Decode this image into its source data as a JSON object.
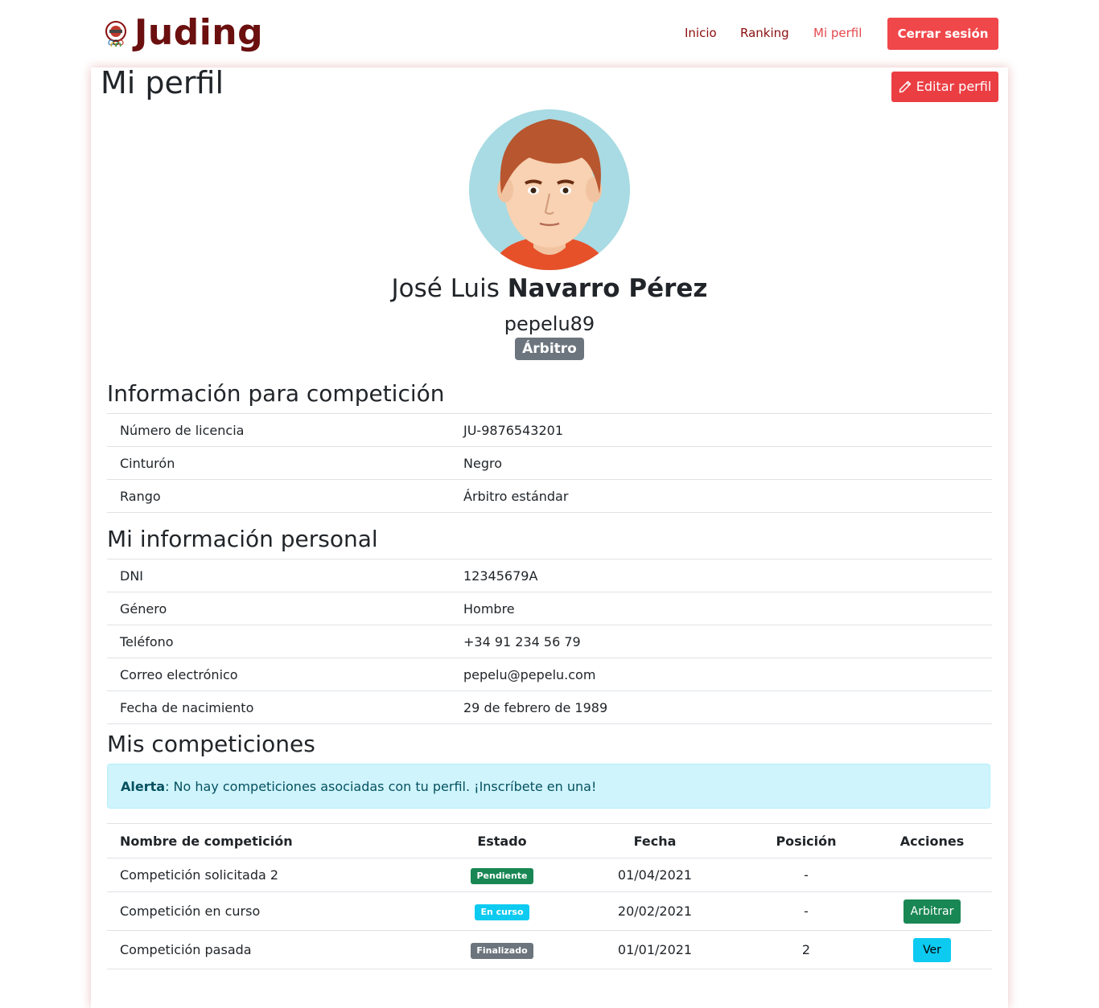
{
  "nav": {
    "brand": "Juding",
    "links": [
      "Inicio",
      "Ranking",
      "Mi perfil"
    ],
    "logout_label": "Cerrar sesión"
  },
  "profile": {
    "title": "Mi perfil",
    "edit_label": "Editar perfil",
    "first_name": "José Luis",
    "last_name": "Navarro Pérez",
    "username": "pepelu89",
    "role": "Árbitro"
  },
  "competition_info": {
    "title": "Información para competición",
    "rows": [
      {
        "label": "Número de licencia",
        "value": "JU-9876543201"
      },
      {
        "label": "Cinturón",
        "value": "Negro"
      },
      {
        "label": "Rango",
        "value": "Árbitro estándar"
      }
    ]
  },
  "personal_info": {
    "title": "Mi información personal",
    "rows": [
      {
        "label": "DNI",
        "value": "12345679A"
      },
      {
        "label": "Género",
        "value": "Hombre"
      },
      {
        "label": "Teléfono",
        "value": "+34 91 234 56 79"
      },
      {
        "label": "Correo electrónico",
        "value": "pepelu@pepelu.com"
      },
      {
        "label": "Fecha de nacimiento",
        "value": "29 de febrero de 1989"
      }
    ]
  },
  "competitions": {
    "title": "Mis competiciones",
    "alert_strong": "Alerta",
    "alert_text": ": No hay competiciones asociadas con tu perfil. ¡Inscríbete en una!",
    "headers": [
      "Nombre de competición",
      "Estado",
      "Fecha",
      "Posición",
      "Acciones"
    ],
    "rows": [
      {
        "name": "Competición solicitada 2",
        "status": "Pendiente",
        "date": "01/04/2021",
        "position": "-",
        "action": ""
      },
      {
        "name": "Competición en curso",
        "status": "En curso",
        "date": "20/02/2021",
        "position": "-",
        "action": "Arbitrar"
      },
      {
        "name": "Competición pasada",
        "status": "Finalizado",
        "date": "01/01/2021",
        "position": "2",
        "action": "Ver"
      }
    ]
  },
  "colors": {
    "brand": "#6b0f0f",
    "danger": "#f0474b",
    "success": "#198754",
    "info": "#0dcaf0",
    "secondary": "#6c757d"
  }
}
